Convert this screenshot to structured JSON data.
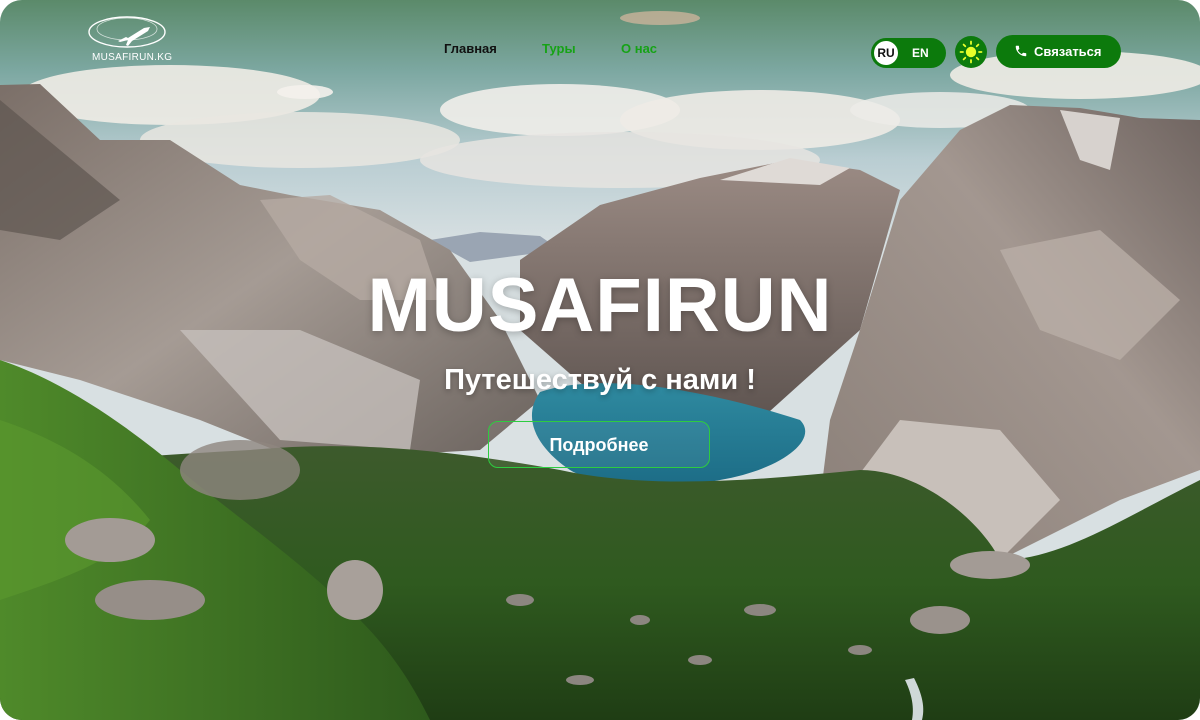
{
  "logo": {
    "text": "MUSAFIRUN.KG",
    "icon": "plane-globe-icon"
  },
  "nav": {
    "home": "Главная",
    "tours": "Туры",
    "about": "О нас"
  },
  "lang": {
    "ru": "RU",
    "en": "EN",
    "active": "RU"
  },
  "theme": {
    "icon": "sun-icon"
  },
  "contact": {
    "label": "Связаться",
    "icon": "phone-icon"
  },
  "hero": {
    "title": "MUSAFIRUN",
    "subtitle": "Путешествуй с нами !",
    "button": "Подробнее"
  },
  "colors": {
    "brand_green": "#0c7a0c",
    "nav_green": "#16a316",
    "button_border": "#2ecc40",
    "sun": "#e8ff2a"
  }
}
